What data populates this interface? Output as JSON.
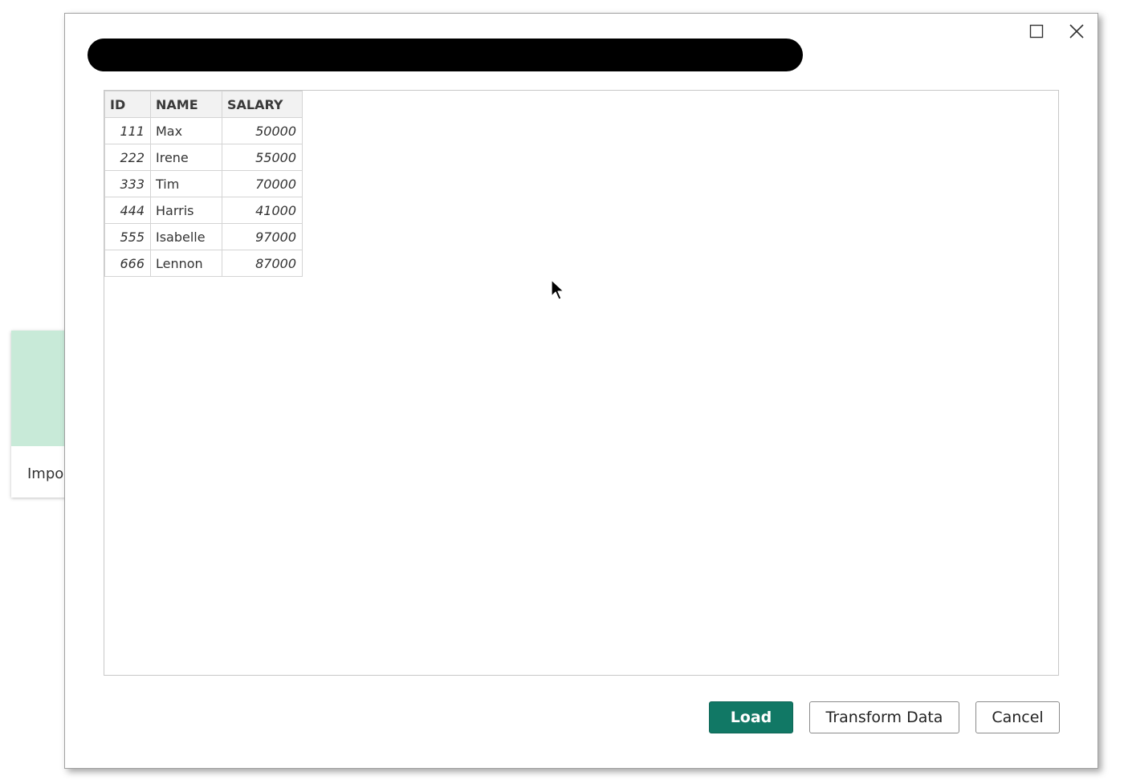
{
  "background_card": {
    "label": "Impo",
    "accent_color": "#c8ead8"
  },
  "dialog": {
    "title_redacted": true,
    "window_controls": {
      "maximize_icon": "maximize-icon",
      "close_icon": "close-icon"
    },
    "table": {
      "columns": [
        "ID",
        "NAME",
        "SALARY"
      ],
      "rows": [
        {
          "id": "111",
          "name": "Max",
          "salary": "50000"
        },
        {
          "id": "222",
          "name": "Irene",
          "salary": "55000"
        },
        {
          "id": "333",
          "name": "Tim",
          "salary": "70000"
        },
        {
          "id": "444",
          "name": "Harris",
          "salary": "41000"
        },
        {
          "id": "555",
          "name": "Isabelle",
          "salary": "97000"
        },
        {
          "id": "666",
          "name": "Lennon",
          "salary": "87000"
        }
      ]
    },
    "buttons": {
      "load": "Load",
      "transform": "Transform Data",
      "cancel": "Cancel"
    },
    "colors": {
      "primary": "#117865"
    }
  }
}
